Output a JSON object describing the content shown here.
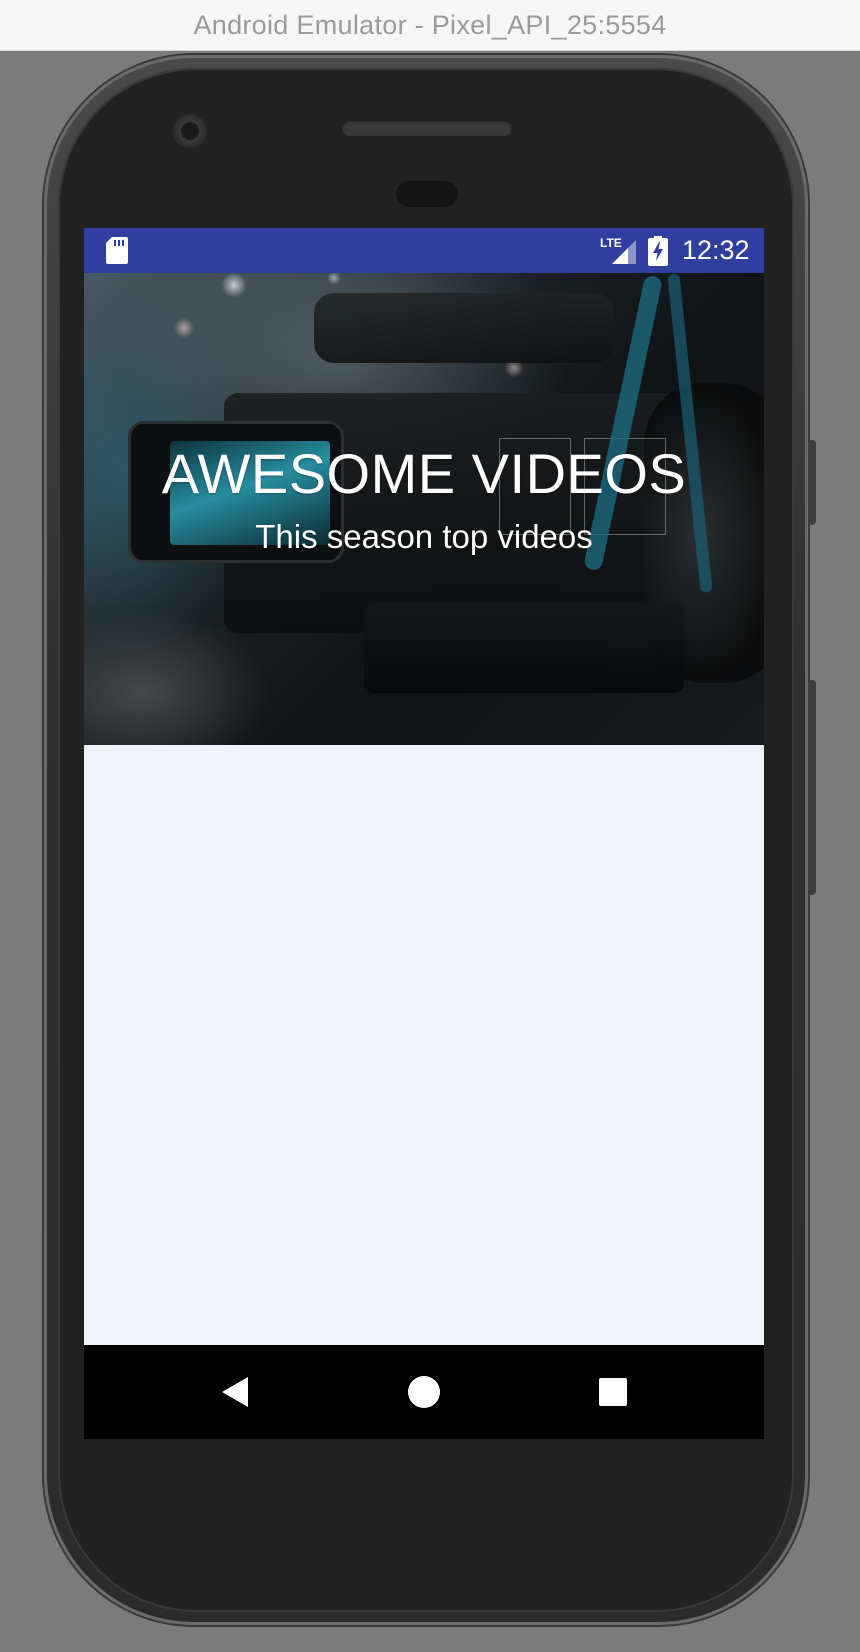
{
  "window": {
    "title": "Android Emulator - Pixel_API_25:5554"
  },
  "status_bar": {
    "time": "12:32",
    "network_label": "LTE",
    "icons": [
      "sd-card-icon",
      "lte-signal-icon",
      "battery-charging-icon"
    ],
    "color": "#303f9f"
  },
  "hero": {
    "title": "AWESOME VIDEOS",
    "subtitle": "This season top videos"
  },
  "navigation_bar": {
    "buttons": [
      "back-icon",
      "home-icon",
      "recents-icon"
    ]
  },
  "colors": {
    "status_bar": "#303f9f",
    "content_background": "#f0f3f7",
    "nav_bar": "#000000"
  }
}
